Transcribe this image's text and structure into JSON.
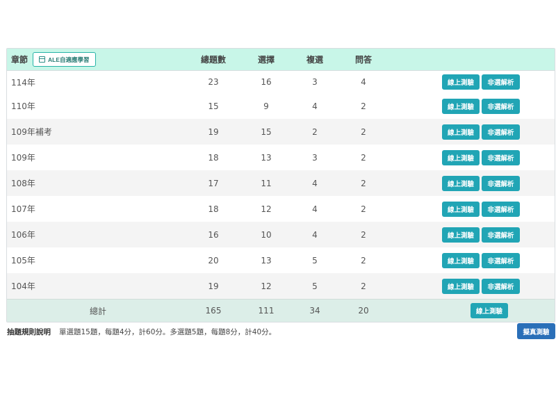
{
  "table": {
    "headers": {
      "chapter": "章節",
      "total": "總題數",
      "single": "選擇",
      "multi": "複選",
      "qa": "問答"
    },
    "ale_button": "ALE自適應學習",
    "test_label": "線上測驗",
    "explain_label": "非選解析",
    "rows": [
      {
        "name": "114年",
        "total": "23",
        "single": "16",
        "multi": "3",
        "qa": "4"
      },
      {
        "name": "110年",
        "total": "15",
        "single": "9",
        "multi": "4",
        "qa": "2"
      },
      {
        "name": "109年補考",
        "total": "19",
        "single": "15",
        "multi": "2",
        "qa": "2"
      },
      {
        "name": "109年",
        "total": "18",
        "single": "13",
        "multi": "3",
        "qa": "2"
      },
      {
        "name": "108年",
        "total": "17",
        "single": "11",
        "multi": "4",
        "qa": "2"
      },
      {
        "name": "107年",
        "total": "18",
        "single": "12",
        "multi": "4",
        "qa": "2"
      },
      {
        "name": "106年",
        "total": "16",
        "single": "10",
        "multi": "4",
        "qa": "2"
      },
      {
        "name": "105年",
        "total": "20",
        "single": "13",
        "multi": "5",
        "qa": "2"
      },
      {
        "name": "104年",
        "total": "19",
        "single": "12",
        "multi": "5",
        "qa": "2"
      }
    ],
    "footer": {
      "name": "總計",
      "total": "165",
      "single": "111",
      "multi": "34",
      "qa": "20",
      "test_label": "線上測驗"
    }
  },
  "rules": {
    "label": "抽題規則說明",
    "text": "單選題15題，每題4分，計60分。多選題5題，每題8分，計40分。"
  },
  "mock_exam_label": "擬真測驗",
  "colors": {
    "header_bg": "#c8f6e8",
    "button": "#21a5b5",
    "mock_button": "#2a6fb8",
    "footer_bg": "#dceee8"
  }
}
